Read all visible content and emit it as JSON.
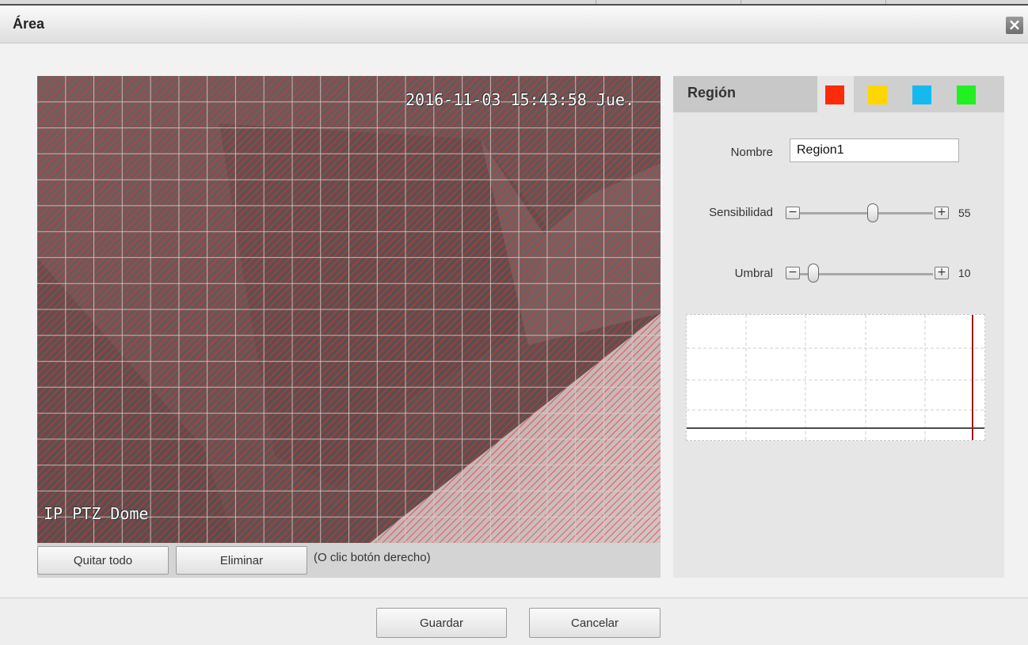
{
  "dialog": {
    "title": "Área",
    "close_symbol": "×"
  },
  "video": {
    "timestamp": "2016-11-03 15:43:58 Jue.",
    "camera_name": "IP PTZ Dome",
    "grid_color": "#ff2a2a"
  },
  "video_toolbar": {
    "clear_all_label": "Quitar todo",
    "delete_label": "Eliminar",
    "hint": "(O clic botón derecho)"
  },
  "region_panel": {
    "tab_label": "Región",
    "swatches": [
      {
        "name": "region-color-red",
        "color": "#ff2a0a",
        "selected": true
      },
      {
        "name": "region-color-yellow",
        "color": "#ffd700",
        "selected": false
      },
      {
        "name": "region-color-cyan",
        "color": "#14b9f0",
        "selected": false
      },
      {
        "name": "region-color-green",
        "color": "#22f022",
        "selected": false
      }
    ],
    "name_label": "Nombre",
    "name_value": "Region1",
    "sensitivity_label": "Sensibilidad",
    "sensitivity_value": "55",
    "sensitivity_fraction": 0.55,
    "threshold_label": "Umbral",
    "threshold_value": "10",
    "threshold_fraction": 0.1,
    "minus_symbol": "−",
    "plus_symbol": "+"
  },
  "footer": {
    "save_label": "Guardar",
    "cancel_label": "Cancelar"
  }
}
